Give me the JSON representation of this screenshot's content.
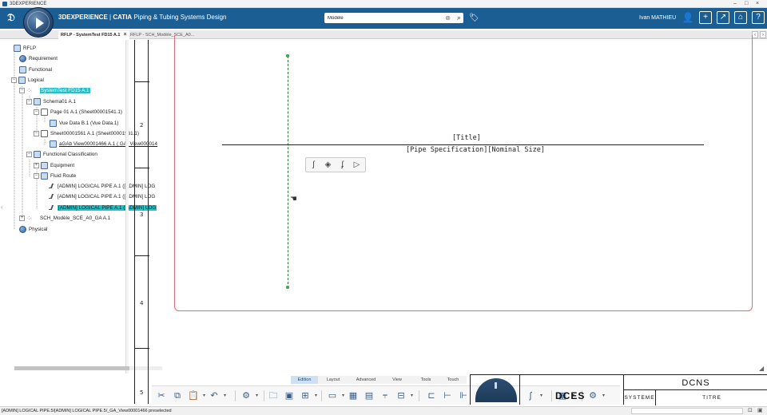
{
  "os": {
    "title": "3DEXPERIENCE"
  },
  "header": {
    "logo": "3DS",
    "brand": "3DEXPERIENCE",
    "separator": "|",
    "product": "CATIA",
    "app": "Piping & Tubing Systems Design",
    "search": {
      "value": "Modèle",
      "clear": "⊗",
      "icon": "search-icon"
    },
    "user": "Ivan MATHIEU",
    "icons": [
      "user-icon",
      "add-icon",
      "share-icon",
      "home-icon",
      "help-icon"
    ]
  },
  "tabs": [
    {
      "label": "RFLP - SystemTest FD15 A.1",
      "close": "×"
    },
    {
      "label": "RFLP - SCH_Modèle_SCE_A0..."
    }
  ],
  "tree": {
    "root": "RFLP",
    "requirement": "Requirement",
    "functional": "Functional",
    "logical": "Logical",
    "system_test": "SystemTest FD15 A.1",
    "schema": "Schema01 A.1",
    "page": "Page 01 A.1 (Sheet00001541.1)",
    "vue": "Vue Data B.1 (Vue Data.1)",
    "sheet": "Sheet00001561 A.1 (Sheet00001561.1)",
    "gab": "aGAb View00001466 A.1 ( GA_View000014",
    "func_class": "Functional Classification",
    "equipment": "Equipment",
    "fluid_route": "Fluid Route",
    "pipes": [
      "[ADMIN] LOGICAL PIPE A.1 ([ADMIN] LOG",
      "[ADMIN] LOGICAL PIPE A.1 ([ADMIN] LOG",
      "[ADMIN] LOGICAL PIPE A.1 ([ADMIN] LOG"
    ],
    "sch_model": "SCH_Modèle_SCE_A0_GA A.1",
    "physical": "Physical"
  },
  "drawing": {
    "ruler": [
      "2",
      "3",
      "4",
      "5"
    ],
    "title_text": "[Title]",
    "spec_text": "[Pipe Specification][Nominal Size]"
  },
  "command_tabs": [
    "Edition",
    "Layout",
    "Advanced",
    "View",
    "Tools",
    "Touch"
  ],
  "title_block": {
    "code": "DCES",
    "company": "DCNS",
    "system": "SYSTEME",
    "title": "TITRE"
  },
  "status": {
    "message": "[ADMIN] LOGICAL PIPE.5/[ADMIN] LOGICAL PIPE.5/_GA_View00001466 preselected"
  },
  "colors": {
    "header_bg": "#1b5e94",
    "selection": "#23c0c6",
    "sheet_border": "#e06a7a",
    "route_line": "#2f7a3a"
  }
}
